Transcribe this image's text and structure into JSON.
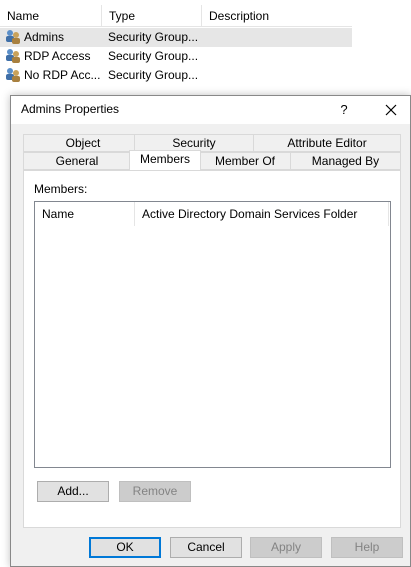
{
  "list": {
    "columns": [
      "Name",
      "Type",
      "Description"
    ],
    "rows": [
      {
        "name": "Admins",
        "type": "Security Group...",
        "selected": true
      },
      {
        "name": "RDP Access",
        "type": "Security Group...",
        "selected": false
      },
      {
        "name": "No RDP Acc...",
        "type": "Security Group...",
        "selected": false
      }
    ]
  },
  "dialog": {
    "title": "Admins Properties",
    "help_glyph": "?",
    "tabs_back": [
      "Object",
      "Security",
      "Attribute Editor"
    ],
    "tabs_front": [
      "General",
      "Members",
      "Member Of",
      "Managed By"
    ],
    "active_tab": "Members",
    "members_label": "Members:",
    "members_columns": [
      "Name",
      "Active Directory Domain Services Folder"
    ],
    "add_button": "Add...",
    "remove_button": "Remove",
    "ok_button": "OK",
    "cancel_button": "Cancel",
    "apply_button": "Apply",
    "help_button": "Help"
  },
  "colors": {
    "dialog_bg": "#f0f0f0",
    "selection_bg": "#e6e6e6",
    "default_button_border": "#0078d7",
    "disabled_text": "#838383"
  },
  "icons": {
    "group": "group-icon",
    "close": "close-icon"
  }
}
